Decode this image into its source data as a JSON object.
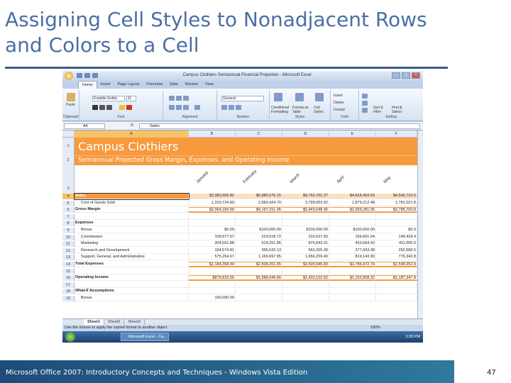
{
  "slide": {
    "title": "Assigning Cell Styles to Nonadjacent Rows and Colors to a Cell",
    "footer": "Microsoft Office 2007: Introductory Concepts and Techniques - Windows Vista Edition",
    "page_number": "47"
  },
  "excel": {
    "window_title": "Campus Clothiers Semiannual Financial Projection - Microsoft Excel",
    "tabs": [
      "Home",
      "Insert",
      "Page Layout",
      "Formulas",
      "Data",
      "Review",
      "View"
    ],
    "ribbon": {
      "font_name": "Franklin Gothic",
      "font_size": "11",
      "number_format": "General",
      "groups": [
        "Clipboard",
        "Font",
        "Alignment",
        "Number",
        "Styles",
        "Cells",
        "Editing"
      ],
      "paste": "Paste",
      "conditional_formatting": "Conditional Formatting",
      "format_as_table": "Format as Table",
      "cell_styles": "Cell Styles",
      "insert": "Insert",
      "delete": "Delete",
      "format": "Format",
      "sort_filter": "Sort & Filter",
      "find_select": "Find & Select"
    },
    "name_box": "A4",
    "formula_bar": "Sales",
    "columns": [
      "A",
      "B",
      "C",
      "D",
      "E",
      "F"
    ],
    "banner_title": "Campus Clothiers",
    "banner_subtitle": "Semiannual Projected Gross Margin, Expenses, and Operating Income",
    "months": [
      "January",
      "February",
      "March",
      "April",
      "May"
    ],
    "rows": [
      {
        "n": "4",
        "label": "Sales",
        "values": [
          "$3,383,909.82",
          "$6,880,576.15",
          "$9,742,702.37",
          "$4,818,493.53",
          "$4,566,722.6"
        ]
      },
      {
        "n": "5",
        "label": "Cost of Goods Sold",
        "values": [
          "1,319,724.83",
          "2,683,424.70",
          "3,799,653.92",
          "1,879,212.48",
          "1,781,021.8"
        ]
      },
      {
        "n": "6",
        "label": "Gross Margin",
        "values": [
          "$2,064,184.99",
          "$4,197,151.45",
          "$5,943,048.45",
          "$2,939,281.05",
          "$2,785,700.8"
        ]
      },
      {
        "n": "7",
        "label": "",
        "values": [
          "",
          "",
          "",
          "",
          ""
        ]
      },
      {
        "n": "8",
        "label": "Expenses",
        "values": [
          "",
          "",
          "",
          "",
          ""
        ]
      },
      {
        "n": "9",
        "label": "Bonus",
        "values": [
          "$0.00",
          "$100,000.00",
          "$100,000.00",
          "$100,000.00",
          "$0.0"
        ]
      },
      {
        "n": "10",
        "label": "Commission",
        "values": [
          "109,977.07",
          "223,618.72",
          "316,637.83",
          "156,601.04",
          "148,418.4"
        ]
      },
      {
        "n": "11",
        "label": "Marketing",
        "values": [
          "304,551.88",
          "619,251.85",
          "876,843.21",
          "433,664.42",
          "411,005.0"
        ]
      },
      {
        "n": "12",
        "label": "Research and Development",
        "values": [
          "194,574.81",
          "395,633.13",
          "560,205.39",
          "277,063.38",
          "262,586.5"
        ]
      },
      {
        "n": "13",
        "label": "Support, General, and Administrative",
        "values": [
          "575,264.67",
          "1,169,697.95",
          "1,656,259.40",
          "819,143.90",
          "776,342.8"
        ]
      },
      {
        "n": "14",
        "label": "Total Expenses",
        "values": [
          "$1,184,368.44",
          "$2,508,201.65",
          "$3,509,945.83",
          "$1,786,472.74",
          "$1,598,352.9"
        ]
      },
      {
        "n": "15",
        "label": "",
        "values": [
          "",
          "",
          "",
          "",
          ""
        ]
      },
      {
        "n": "16",
        "label": "Operating Income",
        "values": [
          "$879,816.55",
          "$1,688,949.80",
          "$2,433,102.62",
          "$1,152,808.32",
          "$1,187,347.8"
        ]
      },
      {
        "n": "17",
        "label": "",
        "values": [
          "",
          "",
          "",
          "",
          ""
        ]
      },
      {
        "n": "18",
        "label": "What-If Assumptions",
        "values": [
          "",
          "",
          "",
          "",
          ""
        ]
      },
      {
        "n": "19",
        "label": "Bonus",
        "values": [
          "100,000.00",
          "",
          "",
          "",
          ""
        ]
      }
    ],
    "sheet_tabs": [
      "Sheet1",
      "Sheet2",
      "Sheet3"
    ],
    "status_text": "Use the mouse to apply the copied format to another object",
    "zoom": "100%",
    "taskbar_item": "Microsoft Excel - Ca...",
    "clock": "3:28 PM"
  }
}
